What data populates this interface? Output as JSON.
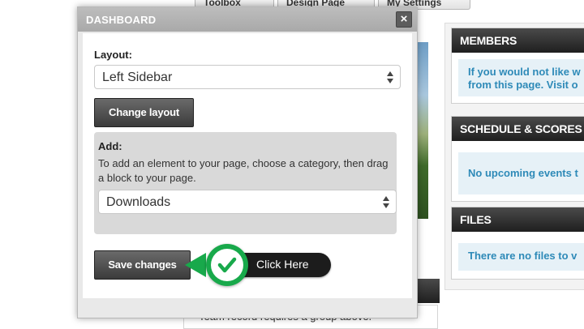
{
  "top_tabs": [
    "Toolbox",
    "Design Page",
    "My Settings"
  ],
  "dialog": {
    "title": "DASHBOARD",
    "close_symbol": "×",
    "layout_label": "Layout:",
    "layout_value": "Left Sidebar",
    "change_layout_button": "Change layout",
    "add_label": "Add:",
    "add_help": "To add an element to your page, choose a category, then drag a block to your page.",
    "category_value": "Downloads",
    "save_button": "Save changes"
  },
  "callout": {
    "text": "Click Here",
    "icon": "check-icon",
    "color": "#18a94b"
  },
  "widgets": [
    {
      "title": "MEMBERS",
      "lines": [
        "If you would not like w",
        "from this page. Visit o"
      ]
    },
    {
      "title": "SCHEDULE & SCORES",
      "lines": [
        "No upcoming events t"
      ]
    },
    {
      "title": "FILES",
      "lines": [
        "There are no files to v"
      ]
    }
  ],
  "background_note": "Team record requires a group above."
}
